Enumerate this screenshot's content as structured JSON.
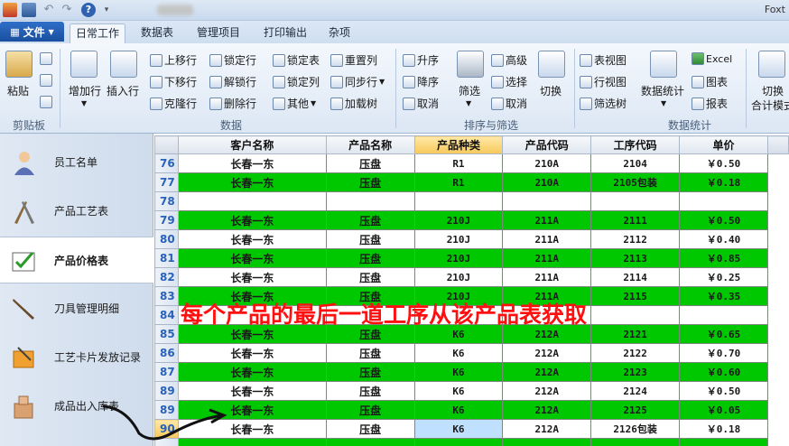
{
  "app": {
    "title_fragment": "Foxt"
  },
  "file_tab": {
    "label": "文件"
  },
  "tabs": [
    "日常工作",
    "数据表",
    "管理项目",
    "打印输出",
    "杂项"
  ],
  "ribbon": {
    "clipboard": {
      "paste": "粘贴",
      "group": "剪贴板"
    },
    "data": {
      "add_row": "增加行",
      "insert_row": "插入行",
      "move_up": "上移行",
      "move_down": "下移行",
      "clone_row": "克隆行",
      "lock_row": "锁定行",
      "unlock_row": "解锁行",
      "delete_row": "删除行",
      "lock_table": "锁定表",
      "lock_col": "锁定列",
      "other": "其他",
      "reset_col": "重置列",
      "sync_row": "同步行",
      "load_tree": "加载树",
      "group": "数据"
    },
    "sort": {
      "asc": "升序",
      "desc": "降序",
      "cancel1": "取消",
      "filter": "筛选",
      "advanced": "高级",
      "select": "选择",
      "cancel2": "取消",
      "switch": "切换",
      "group": "排序与筛选"
    },
    "stats": {
      "table_view": "表视图",
      "row_view": "行视图",
      "filter_tree": "筛选树",
      "data_stats": "数据统计",
      "excel": "Excel",
      "chart": "图表",
      "report": "报表",
      "switch_mode_1": "切换",
      "switch_mode_2": "合计模式",
      "group": "数据统计"
    }
  },
  "sidebar": {
    "items": [
      {
        "label": "员工名单",
        "icon": "person-icon"
      },
      {
        "label": "产品工艺表",
        "icon": "tools-icon"
      },
      {
        "label": "产品价格表",
        "icon": "checklist-icon",
        "active": true
      },
      {
        "label": "刀具管理明细",
        "icon": "knife-icon"
      },
      {
        "label": "工艺卡片发放记录",
        "icon": "card-icon"
      },
      {
        "label": "成品出入库表",
        "icon": "box-icon"
      }
    ]
  },
  "grid": {
    "columns": [
      "客户名称",
      "产品名称",
      "产品种类",
      "产品代码",
      "工序代码",
      "单价"
    ],
    "selected_column": "产品种类",
    "rows": [
      {
        "n": "76",
        "style": "white",
        "cells": [
          "长春一东",
          "压盘",
          "R1",
          "210A",
          "2104",
          "￥0.50"
        ]
      },
      {
        "n": "77",
        "style": "green",
        "cells": [
          "长春一东",
          "压盘",
          "R1",
          "210A",
          "2105包装",
          "￥0.18"
        ]
      },
      {
        "n": "78",
        "style": "white",
        "cells": [
          "",
          "",
          "",
          "",
          "",
          ""
        ]
      },
      {
        "n": "79",
        "style": "green",
        "cells": [
          "长春一东",
          "压盘",
          "210J",
          "211A",
          "2111",
          "￥0.50"
        ]
      },
      {
        "n": "80",
        "style": "white",
        "cells": [
          "长春一东",
          "压盘",
          "210J",
          "211A",
          "2112",
          "￥0.40"
        ]
      },
      {
        "n": "81",
        "style": "green",
        "cells": [
          "长春一东",
          "压盘",
          "210J",
          "211A",
          "2113",
          "￥0.85"
        ]
      },
      {
        "n": "82",
        "style": "white",
        "cells": [
          "长春一东",
          "压盘",
          "210J",
          "211A",
          "2114",
          "￥0.25"
        ]
      },
      {
        "n": "83",
        "style": "green",
        "cells": [
          "长春一东",
          "压盘",
          "210J",
          "211A",
          "2115",
          "￥0.35"
        ]
      },
      {
        "n": "84",
        "style": "white",
        "cells": [
          "",
          "",
          "",
          "",
          "",
          ""
        ]
      },
      {
        "n": "85",
        "style": "green",
        "cells": [
          "长春一东",
          "压盘",
          "K6",
          "212A",
          "2121",
          "￥0.65"
        ]
      },
      {
        "n": "86",
        "style": "white",
        "cells": [
          "长春一东",
          "压盘",
          "K6",
          "212A",
          "2122",
          "￥0.70"
        ]
      },
      {
        "n": "87",
        "style": "green",
        "cells": [
          "长春一东",
          "压盘",
          "K6",
          "212A",
          "2123",
          "￥0.60"
        ]
      },
      {
        "n": "89",
        "style": "white",
        "cells": [
          "长春一东",
          "压盘",
          "K6",
          "212A",
          "2124",
          "￥0.50"
        ]
      },
      {
        "n": "89",
        "style": "green",
        "cells": [
          "长春一东",
          "压盘",
          "K6",
          "212A",
          "2125",
          "￥0.05"
        ]
      },
      {
        "n": "90",
        "style": "white",
        "current": true,
        "cells": [
          "长春一东",
          "压盘",
          "K6",
          "212A",
          "2126包装",
          "￥0.18"
        ]
      },
      {
        "n": "",
        "style": "green",
        "cells": [
          "",
          "",
          "",
          "",
          "",
          ""
        ]
      }
    ]
  },
  "annotation": {
    "text": "每个产品的最后一道工序从该产品表获取",
    "color": "#ff1010"
  }
}
